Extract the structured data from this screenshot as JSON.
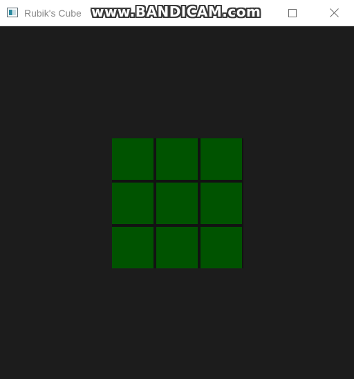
{
  "window": {
    "title": "Rubik's Cube",
    "icon": "app-window-icon",
    "watermark": "www.BANDICAM.com",
    "controls": {
      "maximize_icon": "maximize-icon",
      "close_icon": "close-icon"
    }
  },
  "cube": {
    "visible_face": {
      "rows": 3,
      "cols": 3,
      "stickers": [
        "#005300",
        "#005300",
        "#005300",
        "#005300",
        "#005300",
        "#005300",
        "#005300",
        "#005300",
        "#005300"
      ]
    },
    "background_color": "#1c1c1c"
  }
}
